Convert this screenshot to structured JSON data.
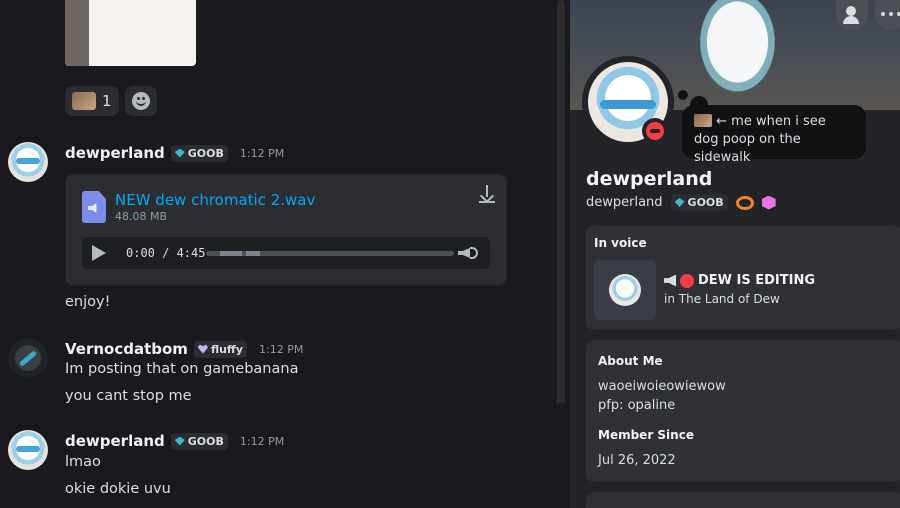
{
  "chat": {
    "reactions": [
      {
        "count": "1"
      }
    ],
    "messages": [
      {
        "author": "dewperland",
        "tag": "GOOB",
        "time": "1:12 PM",
        "attachment": {
          "filename": "NEW dew chromatic 2.wav",
          "size": "48.08 MB",
          "time_display": "0:00 / 4:45",
          "progress": 0.0
        },
        "lines": [
          "enjoy!"
        ]
      },
      {
        "author": "Vernocdatbom",
        "tag": "fluffy",
        "time": "1:12 PM",
        "lines": [
          "Im posting that on gamebanana",
          "you cant stop me"
        ]
      },
      {
        "author": "dewperland",
        "tag": "GOOB",
        "time": "1:12 PM",
        "lines": [
          "lmao",
          "okie dokie uvu"
        ]
      }
    ]
  },
  "profile": {
    "status_text": "← me when i see dog poop on the sidewalk",
    "display_name": "dewperland",
    "username": "dewperland",
    "tag": "GOOB",
    "voice": {
      "heading": "In voice",
      "channel_title": "DEW IS EDITING",
      "server_line": "in The Land of Dew"
    },
    "about": {
      "heading": "About Me",
      "lines": [
        "waoeiwoieowiewow",
        "pfp: opaline"
      ],
      "member_since_heading": "Member Since",
      "member_since": "Jul 26, 2022"
    },
    "colors": {
      "link": "#00a8fc",
      "dnd": "#f23f43",
      "tag_gem": "#3ab7c9"
    }
  }
}
